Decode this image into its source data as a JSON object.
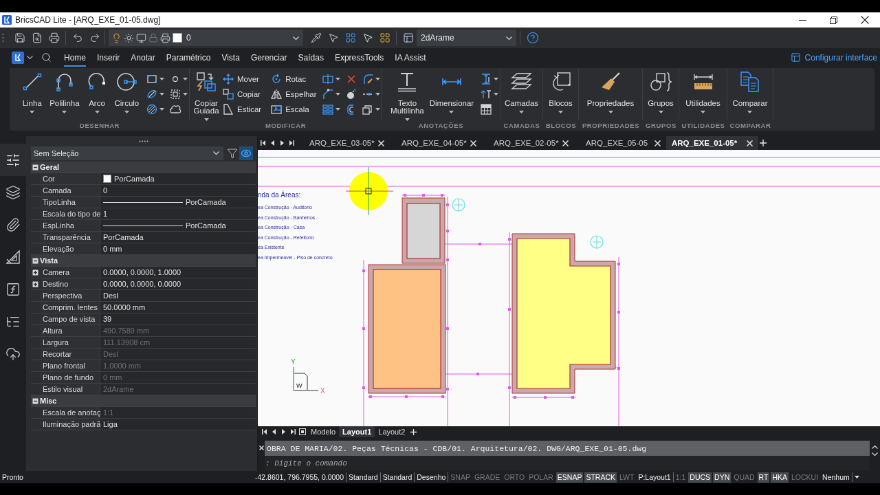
{
  "title_bar": {
    "title": "BricsCAD Lite - [ARQ_EXE_01-05.dwg]"
  },
  "quick_access": {
    "layer": "0",
    "visual_style": "2dArame"
  },
  "ribbon": {
    "tabs": [
      {
        "label": "Home",
        "selected": true
      },
      {
        "label": "Inserir",
        "selected": false
      },
      {
        "label": "Anotar",
        "selected": false
      },
      {
        "label": "Paramétrico",
        "selected": false
      },
      {
        "label": "Vista",
        "selected": false
      },
      {
        "label": "Gerenciar",
        "selected": false
      },
      {
        "label": "Saídas",
        "selected": false
      },
      {
        "label": "ExpressTools",
        "selected": false
      },
      {
        "label": "IA Assist",
        "selected": false
      }
    ],
    "customize": "Configurar interface",
    "panels": [
      {
        "title": "DESENHAR",
        "tools": [
          {
            "kind": "large",
            "label": "Linha"
          },
          {
            "kind": "large",
            "label": "Polilinha"
          },
          {
            "kind": "large",
            "label": "Arco"
          },
          {
            "kind": "large",
            "label": "Circulo"
          }
        ]
      },
      {
        "title": "MODIFICAR",
        "tools": [
          {
            "kind": "large",
            "label": "Copiar Guiada"
          },
          {
            "kind": "medium",
            "label": "Mover"
          },
          {
            "kind": "medium",
            "label": "Copiar"
          },
          {
            "kind": "medium",
            "label": "Esticar"
          },
          {
            "kind": "medium",
            "label": "Rotac"
          },
          {
            "kind": "medium",
            "label": "Espelhar"
          },
          {
            "kind": "medium",
            "label": "Escala"
          }
        ]
      },
      {
        "title": "ANOTAÇÕES",
        "tools": [
          {
            "kind": "large",
            "label": "Texto Multilinha"
          },
          {
            "kind": "large",
            "label": "Dimensionar"
          }
        ]
      },
      {
        "title": "CAMADAS",
        "tools": [
          {
            "kind": "large",
            "label": "Camadas"
          }
        ]
      },
      {
        "title": "BLOCOS",
        "tools": [
          {
            "kind": "large",
            "label": "Blocos"
          }
        ]
      },
      {
        "title": "PROPRIEDADES",
        "tools": [
          {
            "kind": "large",
            "label": "Propriedades"
          }
        ]
      },
      {
        "title": "GRUPOS",
        "tools": [
          {
            "kind": "large",
            "label": "Grupos"
          }
        ]
      },
      {
        "title": "UTILIDADES",
        "tools": [
          {
            "kind": "large",
            "label": "Utilidades"
          }
        ]
      },
      {
        "title": "COMPARAR",
        "tools": [
          {
            "kind": "large",
            "label": "Comparar"
          }
        ]
      }
    ]
  },
  "dock_tabs": [
    {
      "selected": true
    },
    {
      "selected": false
    },
    {
      "selected": false
    },
    {
      "selected": false
    },
    {
      "selected": false
    },
    {
      "selected": false
    },
    {
      "selected": false
    }
  ],
  "properties": {
    "selection": "Sem Seleção",
    "filter_on": false,
    "preview_on": true,
    "sections": [
      {
        "title": "Geral",
        "expanded": true,
        "rows": [
          {
            "kind": "color",
            "name": "Cor",
            "value": "PorCamada",
            "disabled": false
          },
          {
            "kind": "text",
            "name": "Camada",
            "value": "0",
            "disabled": false
          },
          {
            "kind": "line",
            "name": "TipoLinha",
            "value": "PorCamada",
            "disabled": false
          },
          {
            "kind": "text",
            "name": "Escala do tipo de",
            "value": "1",
            "disabled": false
          },
          {
            "kind": "line",
            "name": "EspLinha",
            "value": "PorCamada",
            "disabled": false
          },
          {
            "kind": "text",
            "name": "Transparência",
            "value": "PorCamada",
            "disabled": false
          },
          {
            "kind": "text",
            "name": "Elevação",
            "value": "0 mm",
            "disabled": false
          }
        ]
      },
      {
        "title": "Vista",
        "expanded": true,
        "rows": [
          {
            "kind": "compound",
            "name": "Camera",
            "value": "0.0000, 0.0000, 1.0000",
            "disabled": false,
            "expanded": false
          },
          {
            "kind": "compound",
            "name": "Destino",
            "value": "0.0000, 0.0000, 0.0000",
            "disabled": false,
            "expanded": false
          },
          {
            "kind": "text",
            "name": "Perspectiva",
            "value": "Desl",
            "disabled": false
          },
          {
            "kind": "text",
            "name": "Comprim. lentes",
            "value": "50.0000 mm",
            "disabled": false
          },
          {
            "kind": "text",
            "name": "Campo de vista",
            "value": "39",
            "disabled": false
          },
          {
            "kind": "text",
            "name": "Altura",
            "value": "490.7589 mm",
            "disabled": true
          },
          {
            "kind": "text",
            "name": "Largura",
            "value": "111.13908 cm",
            "disabled": true
          },
          {
            "kind": "text",
            "name": "Recortar",
            "value": "Desl",
            "disabled": true
          },
          {
            "kind": "text",
            "name": "Plano frontal",
            "value": "1.0000 mm",
            "disabled": true
          },
          {
            "kind": "text",
            "name": "Plano de fundo",
            "value": "0 mm",
            "disabled": true
          },
          {
            "kind": "text",
            "name": "Estilo visual",
            "value": "2dArame",
            "disabled": true
          }
        ]
      },
      {
        "title": "Misc",
        "expanded": true,
        "rows": [
          {
            "kind": "text",
            "name": "Escala de anotaç",
            "value": "1:1",
            "disabled": true
          },
          {
            "kind": "text",
            "name": "Iluminação padrã",
            "value": "Liga",
            "disabled": false
          }
        ]
      }
    ]
  },
  "document_tabs": [
    {
      "label": "ARQ_EXE_03-05*",
      "selected": false
    },
    {
      "label": "ARQ_EXE_04-05*",
      "selected": false
    },
    {
      "label": "ARQ_EXE_02-05*",
      "selected": false
    },
    {
      "label": "ARQ_EXE_05-05",
      "selected": false
    },
    {
      "label": "ARQ_EXE_01-05*",
      "selected": true
    }
  ],
  "canvas": {
    "legend": {
      "title": "nda da Áreas:",
      "items": [
        "ea Construção - Auditorio",
        "ea Construção - Banheiros",
        "ea Construção - Casa",
        "ea Construção - Refeitorio",
        "ea Existente",
        "ea Impermeavel - Piso de concreto"
      ]
    },
    "ucs": {
      "y_axis": "Y",
      "x_axis": "X",
      "plane": "W"
    }
  },
  "layout_tabs": [
    {
      "label": "Modelo",
      "selected": false
    },
    {
      "label": "Layout1",
      "selected": true
    },
    {
      "label": "Layout2",
      "selected": false
    }
  ],
  "command_line": {
    "history": "OBRA DE MARIA/02. Peças Técnicas - CDB/01. Arquitetura/02. DWG/ARQ_EXE_01-05.dwg",
    "placeholder": ": Digite o comando"
  },
  "status_bar": {
    "message": "Pronto",
    "fields": [
      {
        "kind": "text",
        "label": "-42.8601, 796.7955, 0.0000"
      },
      {
        "kind": "text",
        "label": "Standard"
      },
      {
        "kind": "text",
        "label": "Standard"
      },
      {
        "kind": "text",
        "label": "Desenho"
      },
      {
        "kind": "toggle",
        "label": "SNAP",
        "on": false
      },
      {
        "kind": "toggle",
        "label": "GRADE",
        "on": false
      },
      {
        "kind": "toggle",
        "label": "ORTO",
        "on": false
      },
      {
        "kind": "toggle",
        "label": "POLAR",
        "on": false
      },
      {
        "kind": "toggle",
        "label": "ESNAP",
        "on": true
      },
      {
        "kind": "toggle",
        "label": "STRACK",
        "on": true
      },
      {
        "kind": "toggle",
        "label": "LWT",
        "on": false
      },
      {
        "kind": "text",
        "label": "P:Layout1"
      },
      {
        "kind": "toggle",
        "label": "1:1",
        "on": false
      },
      {
        "kind": "toggle",
        "label": "DUCS",
        "on": true
      },
      {
        "kind": "toggle",
        "label": "DYN",
        "on": true
      },
      {
        "kind": "toggle",
        "label": "QUAD",
        "on": false
      },
      {
        "kind": "toggle",
        "label": "RT",
        "on": true
      },
      {
        "kind": "toggle",
        "label": "HKA",
        "on": true
      },
      {
        "kind": "toggle",
        "label": "LOCKUI",
        "on": false
      },
      {
        "kind": "text",
        "label": "Nenhum"
      }
    ]
  }
}
